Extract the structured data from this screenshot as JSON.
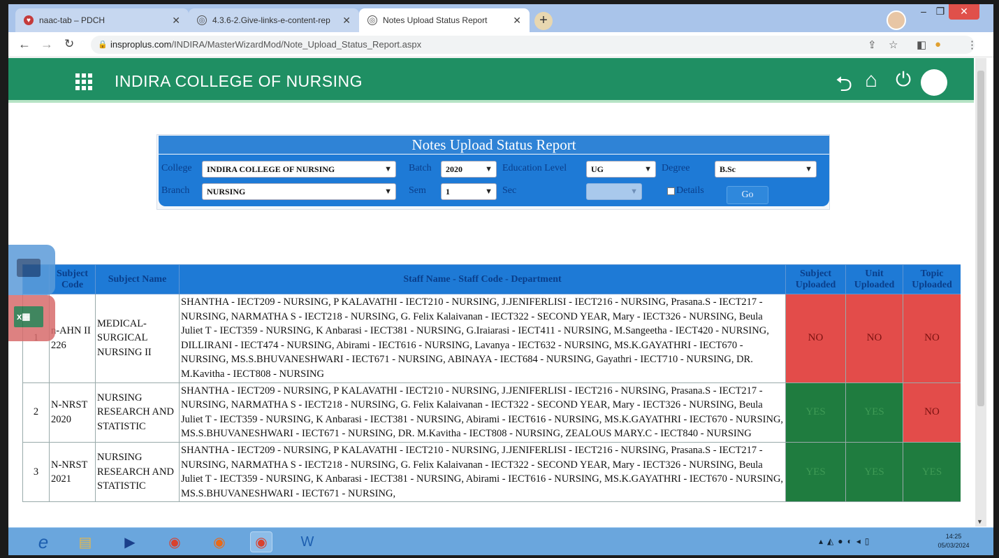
{
  "browser": {
    "tabs": [
      {
        "title": "naac-tab – PDCH",
        "active": false
      },
      {
        "title": "4.3.6-2.Give-links-e-content-rep",
        "active": false
      },
      {
        "title": "Notes Upload Status Report",
        "active": true
      }
    ],
    "new_tab_label": "+",
    "url_host": "insproplus.com",
    "url_path": "/INDIRA/MasterWizardMod/Note_Upload_Status_Report.aspx"
  },
  "header": {
    "college_name": "INDIRA COLLEGE OF NURSING"
  },
  "report": {
    "title": "Notes Upload Status Report",
    "filters": {
      "college_label": "College",
      "college_value": "INDIRA COLLEGE OF NURSING",
      "batch_label": "Batch",
      "batch_value": "2020",
      "education_level_label": "Education Level",
      "education_level_value": "UG",
      "degree_label": "Degree",
      "degree_value": "B.Sc",
      "branch_label": "Branch",
      "branch_value": "NURSING",
      "sem_label": "Sem",
      "sem_value": "1",
      "sec_label": "Sec",
      "sec_value": "",
      "details_label": "Details",
      "go_label": "Go"
    }
  },
  "table": {
    "headers": {
      "subject_code": "Subject Code",
      "subject_name": "Subject Name",
      "staff": "Staff Name - Staff Code - Department",
      "subject_uploaded": "Subject Uploaded",
      "unit_uploaded": "Unit Uploaded",
      "topic_uploaded": "Topic Uploaded"
    },
    "rows": [
      {
        "sno": "1",
        "code": "n-AHN II 226",
        "name": "MEDICAL-SURGICAL NURSING II",
        "staff": "SHANTHA - IECT209 - NURSING, P KALAVATHI - IECT210 - NURSING, J.JENIFERLISI - IECT216 - NURSING, Prasana.S - IECT217 - NURSING, NARMATHA S - IECT218 - NURSING, G. Felix Kalaivanan - IECT322 - SECOND YEAR, Mary - IECT326 - NURSING, Beula Juliet T - IECT359 - NURSING, K Anbarasi - IECT381 - NURSING, G.Iraiarasi - IECT411 - NURSING, M.Sangeetha - IECT420 - NURSING, DILLIRANI - IECT474 - NURSING, Abirami - IECT616 - NURSING, Lavanya - IECT632 - NURSING, MS.K.GAYATHRI - IECT670 - NURSING, MS.S.BHUVANESHWARI - IECT671 - NURSING, ABINAYA - IECT684 - NURSING, Gayathri - IECT710 - NURSING, DR. M.Kavitha - IECT808 - NURSING",
        "subject": "NO",
        "unit": "NO",
        "topic": "NO"
      },
      {
        "sno": "2",
        "code": "N-NRST 2020",
        "name": "NURSING RESEARCH AND STATISTIC",
        "staff": "SHANTHA - IECT209 - NURSING, P KALAVATHI - IECT210 - NURSING, J.JENIFERLISI - IECT216 - NURSING, Prasana.S - IECT217 - NURSING, NARMATHA S - IECT218 - NURSING, G. Felix Kalaivanan - IECT322 - SECOND YEAR, Mary - IECT326 - NURSING, Beula Juliet T - IECT359 - NURSING, K Anbarasi - IECT381 - NURSING, Abirami - IECT616 - NURSING, MS.K.GAYATHRI - IECT670 - NURSING, MS.S.BHUVANESHWARI - IECT671 - NURSING, DR. M.Kavitha - IECT808 - NURSING, ZEALOUS MARY.C - IECT840 - NURSING",
        "subject": "YES",
        "unit": "YES",
        "topic": "NO"
      },
      {
        "sno": "3",
        "code": "N-NRST 2021",
        "name": "NURSING RESEARCH AND STATISTIC",
        "staff": "SHANTHA - IECT209 - NURSING, P KALAVATHI - IECT210 - NURSING, J.JENIFERLISI - IECT216 - NURSING, Prasana.S - IECT217 - NURSING, NARMATHA S - IECT218 - NURSING, G. Felix Kalaivanan - IECT322 - SECOND YEAR, Mary - IECT326 - NURSING, Beula Juliet T - IECT359 - NURSING, K Anbarasi - IECT381 - NURSING, Abirami - IECT616 - NURSING, MS.K.GAYATHRI - IECT670 - NURSING, MS.S.BHUVANESHWARI - IECT671 - NURSING,",
        "subject": "YES",
        "unit": "YES",
        "topic": "YES"
      }
    ]
  },
  "taskbar": {
    "clock_time": "14:25",
    "clock_date": "05/03/2024"
  },
  "colors": {
    "header_green": "#1f8f63",
    "panel_blue": "#1e7ad6",
    "status_no": "#e34c4a",
    "status_yes": "#1f7c3f"
  },
  "icons": {
    "apps": "grid-icon",
    "back": "reply-arrow-icon",
    "home": "home-icon",
    "power": "power-icon",
    "print": "printer-icon",
    "excel": "excel-icon"
  }
}
